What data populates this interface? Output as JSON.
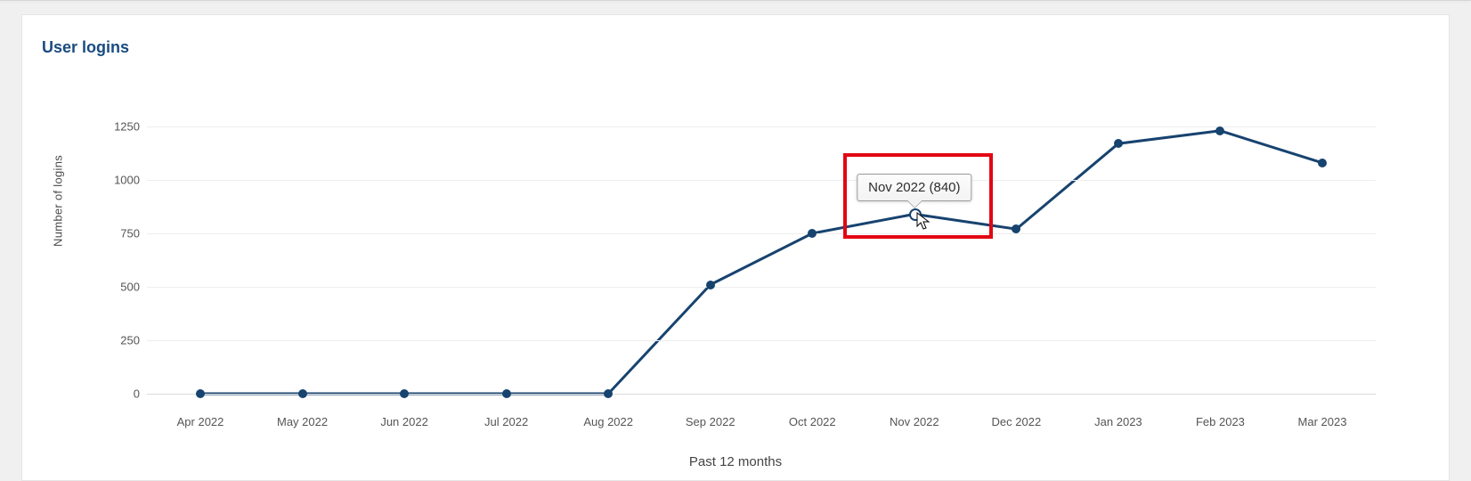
{
  "card": {
    "title": "User logins"
  },
  "chart_data": {
    "type": "line",
    "title": "User logins",
    "xlabel": "Past 12 months",
    "ylabel": "Number of logins",
    "ylim": [
      0,
      1250
    ],
    "y_ticks": [
      0,
      250,
      500,
      750,
      1000,
      1250
    ],
    "categories": [
      "Apr 2022",
      "May 2022",
      "Jun 2022",
      "Jul 2022",
      "Aug 2022",
      "Sep 2022",
      "Oct 2022",
      "Nov 2022",
      "Dec 2022",
      "Jan 2023",
      "Feb 2023",
      "Mar 2023"
    ],
    "values": [
      0,
      0,
      0,
      0,
      0,
      510,
      750,
      840,
      770,
      1170,
      1230,
      1080
    ]
  },
  "tooltip": {
    "text": "Nov 2022 (840)",
    "category_index": 7
  },
  "highlight": {
    "category_index": 7
  },
  "colors": {
    "line": "#17436f",
    "highlight_border": "#e30613",
    "title": "#194b80"
  }
}
